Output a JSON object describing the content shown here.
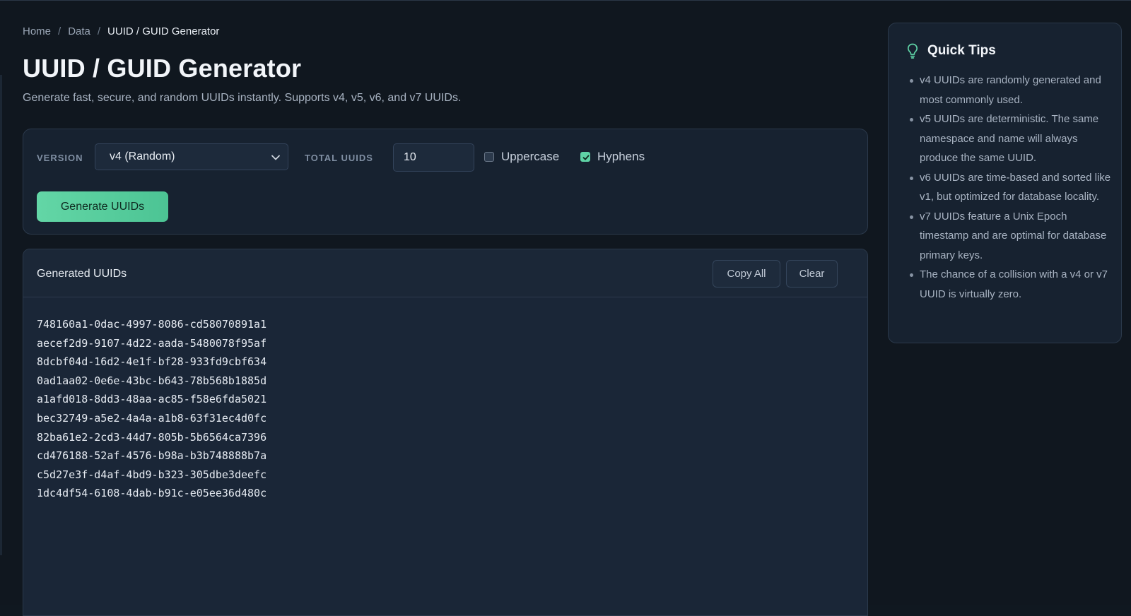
{
  "breadcrumb": {
    "items": [
      "Home",
      "Data"
    ],
    "separator": "/",
    "current": "UUID / GUID Generator"
  },
  "page": {
    "title": "UUID / GUID Generator",
    "subtitle": "Generate fast, secure, and random UUIDs instantly. Supports v4, v5, v6, and v7 UUIDs."
  },
  "controls": {
    "version_label": "VERSION",
    "version_selected": "v4 (Random)",
    "total_label": "TOTAL UUIDS",
    "total_value": "10",
    "uppercase_label": "Uppercase",
    "uppercase_checked": false,
    "hyphens_label": "Hyphens",
    "hyphens_checked": true,
    "generate_label": "Generate UUIDs"
  },
  "output": {
    "title": "Generated UUIDs",
    "copy_all_label": "Copy All",
    "clear_label": "Clear",
    "uuids": [
      "748160a1-0dac-4997-8086-cd58070891a1",
      "aecef2d9-9107-4d22-aada-5480078f95af",
      "8dcbf04d-16d2-4e1f-bf28-933fd9cbf634",
      "0ad1aa02-0e6e-43bc-b643-78b568b1885d",
      "a1afd018-8dd3-48aa-ac85-f58e6fda5021",
      "bec32749-a5e2-4a4a-a1b8-63f31ec4d0fc",
      "82ba61e2-2cd3-44d7-805b-5b6564ca7396",
      "cd476188-52af-4576-b98a-b3b748888b7a",
      "c5d27e3f-d4af-4bd9-b323-305dbe3deefc",
      "1dc4df54-6108-4dab-b91c-e05ee36d480c"
    ]
  },
  "tips": {
    "title": "Quick Tips",
    "icon": "lightbulb-icon",
    "items": [
      "v4 UUIDs are randomly generated and most commonly used.",
      "v5 UUIDs are deterministic. The same namespace and name will always produce the same UUID.",
      "v6 UUIDs are time-based and sorted like v1, but optimized for database locality.",
      "v7 UUIDs feature a Unix Epoch timestamp and are optimal for database primary keys.",
      "The chance of a collision with a v4 or v7 UUID is virtually zero."
    ]
  },
  "colors": {
    "accent": "#5fd3a6",
    "background": "#10171f",
    "card": "#172230"
  }
}
